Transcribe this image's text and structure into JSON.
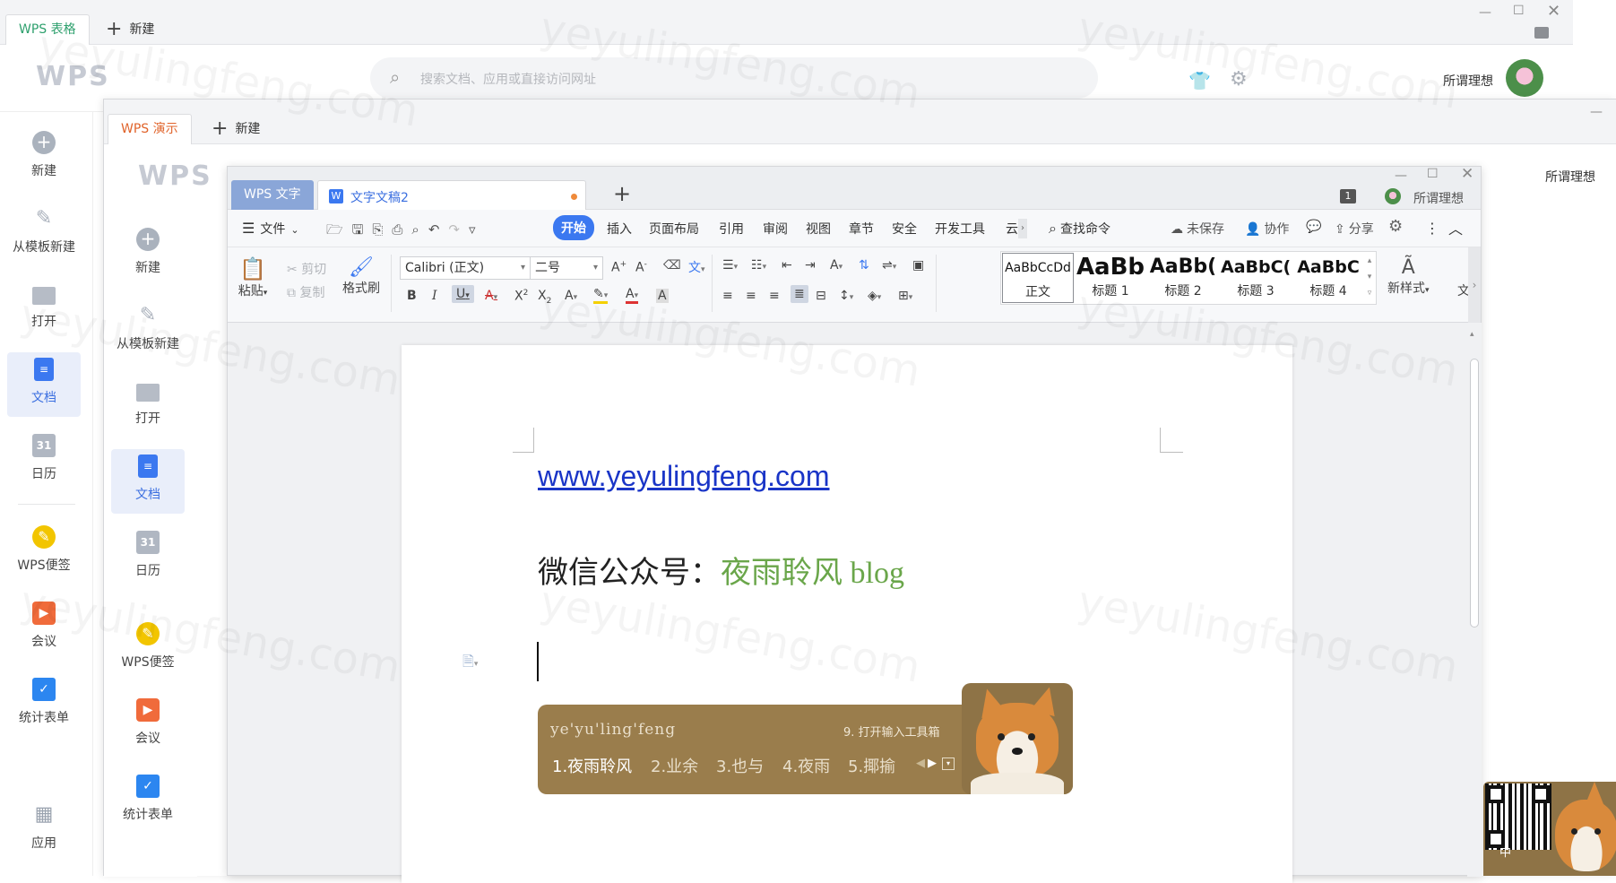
{
  "back_window": {
    "tab_label": "WPS 表格",
    "new_tab_label": "新建",
    "search_placeholder": "搜索文档、应用或直接访问网址",
    "user_name": "所谓理想",
    "sidebar": [
      {
        "label": "新建"
      },
      {
        "label": "从模板新建"
      },
      {
        "label": "打开"
      },
      {
        "label": "文档"
      },
      {
        "label": "日历"
      },
      {
        "label": "WPS便签"
      },
      {
        "label": "会议"
      },
      {
        "label": "统计表单"
      },
      {
        "label": "应用"
      }
    ]
  },
  "mid_window": {
    "tab_label": "WPS 演示",
    "new_tab_label": "新建",
    "user_name": "所谓理想",
    "sidebar": [
      {
        "label": "新建"
      },
      {
        "label": "从模板新建"
      },
      {
        "label": "打开"
      },
      {
        "label": "文档"
      },
      {
        "label": "日历"
      },
      {
        "label": "WPS便签"
      },
      {
        "label": "会议"
      },
      {
        "label": "统计表单"
      }
    ]
  },
  "writer": {
    "app_tab_label": "WPS 文字",
    "doc_tab_label": "文字文稿2",
    "page_count_badge": "1",
    "user_name": "所谓理想",
    "menu": {
      "file": "文件",
      "items": [
        "开始",
        "插入",
        "页面布局",
        "引用",
        "审阅",
        "视图",
        "章节",
        "安全",
        "开发工具",
        "云"
      ],
      "active": "开始",
      "search_command": "查找命令",
      "unsaved": "未保存",
      "collaborate": "协作",
      "share": "分享"
    },
    "ribbon": {
      "paste": "粘贴",
      "cut": "剪切",
      "copy": "复制",
      "format_painter": "格式刷",
      "font_name": "Calibri (正文)",
      "font_size": "二号",
      "new_style": "新样式",
      "overflow_label": "文",
      "styles": [
        {
          "preview": "AaBbCcDd",
          "name": "正文"
        },
        {
          "preview": "AaBb",
          "name": "标题 1"
        },
        {
          "preview": "AaBb(",
          "name": "标题 2"
        },
        {
          "preview": "AaBbC(",
          "name": "标题 3"
        },
        {
          "preview": "AaBbC",
          "name": "标题 4"
        }
      ]
    },
    "document": {
      "link_text": "www.yeyulingfeng.com",
      "line2_prefix": "微信公众号：",
      "line2_highlight": "夜雨聆风 blog"
    }
  },
  "ime": {
    "pinyin": "ye'yu'ling'feng",
    "toolbox": "9. 打开输入工具箱",
    "candidates": [
      "1.夜雨聆风",
      "2.业余",
      "3.也与",
      "4.夜雨",
      "5.揶揄"
    ],
    "tray_lang": "中"
  },
  "watermark": "yeyulingfeng.com",
  "colors": {
    "link": "#1a35c7",
    "green_text": "#6aa64a",
    "accent_blue": "#3b78f0",
    "tab_green": "#2ea06d",
    "tab_orange": "#e0632a",
    "ime_bg": "#9a7d4c"
  }
}
